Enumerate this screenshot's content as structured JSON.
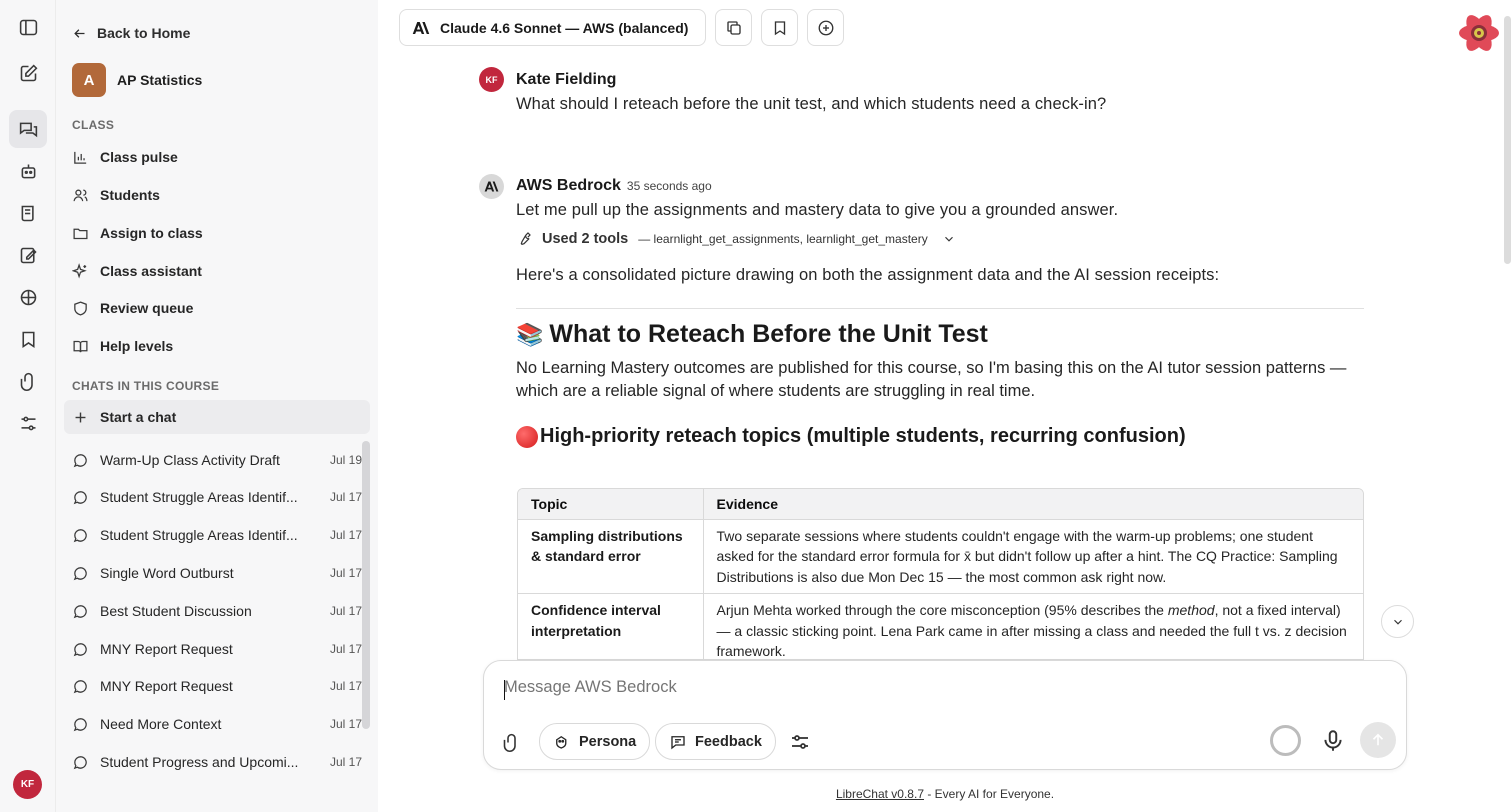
{
  "rail": {
    "items": [
      "sidebar-toggle",
      "new-chat",
      "chats",
      "agents",
      "prompts",
      "assignments",
      "memories",
      "bookmarks",
      "files",
      "controls"
    ],
    "avatar_initials": "KF"
  },
  "sidebar": {
    "back_label": "Back to Home",
    "course_badge": "A",
    "course_name": "AP Statistics",
    "class_section_label": "CLASS",
    "class_items": [
      {
        "label": "Class pulse",
        "icon": "bar-chart-icon"
      },
      {
        "label": "Students",
        "icon": "users-icon"
      },
      {
        "label": "Assign to class",
        "icon": "folder-icon"
      },
      {
        "label": "Class assistant",
        "icon": "sparkle-icon"
      },
      {
        "label": "Review queue",
        "icon": "shield-icon"
      },
      {
        "label": "Help levels",
        "icon": "book-open-icon"
      }
    ],
    "chats_section_label": "CHATS IN THIS COURSE",
    "start_chat_label": "Start a chat",
    "chats": [
      {
        "title": "Warm-Up Class Activity Draft",
        "date": "Jul 19"
      },
      {
        "title": "Student Struggle Areas Identif...",
        "date": "Jul 17"
      },
      {
        "title": "Student Struggle Areas Identif...",
        "date": "Jul 17"
      },
      {
        "title": "Single Word Outburst",
        "date": "Jul 17"
      },
      {
        "title": "Best Student Discussion",
        "date": "Jul 17"
      },
      {
        "title": "MNY Report Request",
        "date": "Jul 17"
      },
      {
        "title": "MNY Report Request",
        "date": "Jul 17"
      },
      {
        "title": "Need More Context",
        "date": "Jul 17"
      },
      {
        "title": "Student Progress and Upcomi...",
        "date": "Jul 17"
      }
    ]
  },
  "header": {
    "model_label": "Claude 4.6 Sonnet — AWS (balanced)"
  },
  "conversation": {
    "user": {
      "initials": "KF",
      "name": "Kate Fielding",
      "text": "What should I reteach before the unit test, and which students need a check-in?"
    },
    "assistant": {
      "name": "AWS Bedrock",
      "time": "35 seconds ago",
      "intro": "Let me pull up the assignments and mastery data to give you a grounded answer.",
      "tools_label": "Used 2 tools",
      "tools_names": "— learnlight_get_assignments, learnlight_get_mastery",
      "summary": "Here's a consolidated picture drawing on both the assignment data and the AI session receipts:",
      "heading_emoji": "📚",
      "heading": "What to Reteach Before the Unit Test",
      "paragraph": "No Learning Mastery outcomes are published for this course, so I'm basing this on the AI tutor session patterns — which are a reliable signal of where students are struggling in real time.",
      "subheading": "High-priority reteach topics (multiple students, recurring confusion)",
      "table": {
        "headers": [
          "Topic",
          "Evidence"
        ],
        "rows": [
          {
            "topic": "Sampling distributions & standard error",
            "evidence": "Two separate sessions where students couldn't engage with the warm-up problems; one student asked for the standard error formula for x̄ but didn't follow up after a hint. The CQ Practice: Sampling Distributions is also due Mon Dec 15 — the most common ask right now."
          },
          {
            "topic": "Confidence interval interpretation",
            "evidence_before": "Arjun Mehta worked through the core misconception (95% describes the ",
            "evidence_em": "method",
            "evidence_after": ", not a fixed interval) — a classic sticking point. Lena Park came in after missing a class and needed the full t vs. z decision framework."
          }
        ]
      }
    }
  },
  "composer": {
    "placeholder": "Message AWS Bedrock",
    "persona_label": "Persona",
    "feedback_label": "Feedback"
  },
  "footer": {
    "link_text": "LibreChat v0.8.7",
    "tagline": " - Every AI for Everyone."
  }
}
